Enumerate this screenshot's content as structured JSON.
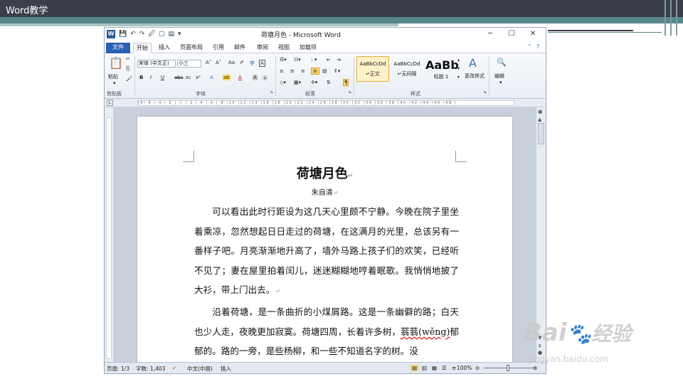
{
  "slide": {
    "title": "Word教学"
  },
  "window": {
    "title": "荷塘月色 - Microsoft Word",
    "controls": {
      "minimize": "─",
      "maximize": "☐",
      "close": "✕"
    },
    "quick_access": [
      "💾",
      "↶",
      "↷",
      "🖉",
      "▢",
      "▤",
      "▾"
    ]
  },
  "tabs": {
    "file": "文件",
    "home": "开始",
    "insert": "插入",
    "layout": "页面布局",
    "references": "引用",
    "mailings": "邮件",
    "review": "审阅",
    "view": "视图",
    "addins": "加载项",
    "help": "?"
  },
  "ribbon": {
    "clipboard": {
      "paste": "粘贴",
      "label": "剪贴板"
    },
    "font": {
      "name": "宋体 (中文正)",
      "size": "小三",
      "label": "字体",
      "buttons": [
        "B",
        "I",
        "U",
        "abc",
        "x₂",
        "x²",
        "A",
        "A",
        "Aa",
        "A",
        "ㅅ",
        "A",
        "Ⓐ",
        "字"
      ]
    },
    "paragraph": {
      "label": "段落"
    },
    "styles": {
      "label": "样式",
      "items": [
        {
          "sample": "AaBbCcDd",
          "name": "↵正文"
        },
        {
          "sample": "AaBbCcDd",
          "name": "↵无间隔"
        },
        {
          "sample": "AaBb",
          "name": "标题 1"
        }
      ],
      "change": "更改样式"
    },
    "editing": {
      "label": "编辑"
    }
  },
  "ruler": {
    "marks": "|8|·6·|·4·|·2·|·▽·|·2·|·4·|·6·|·8·|10·|12·|14·|16·|18·|20·|22·|24·|26·|28·|30·|32·|34·|36·|38·|40·|42·|44·|46·|48·|"
  },
  "document": {
    "title": "荷塘月色",
    "title_mark": "↵",
    "author": "朱自清",
    "author_mark": "↵",
    "para1": "可以看出此时行距设为这几天心里颇不宁静。今晚在院子里坐着乘凉，忽然想起日日走过的荷塘，在这满月的光里，总该另有一番样子吧。月亮渐渐地升高了，墙外马路上孩子们的欢笑，已经听不见了；妻在屋里拍着闰儿，迷迷糊糊地哼着眠歌。我悄悄地披了大衫，带上门出去。",
    "para1_mark": "↵",
    "para2_a": "沿着荷塘，是一条曲折的小煤屑路。这是一条幽僻的路；白天也少人走，夜晚更加寂寞。荷塘四周，长着许多树，",
    "para2_u1": "蓊蓊(wě",
    "para2_u2": "ng)",
    "para2_b": "郁郁的。路的一旁，是些杨柳，和一些不知道名字的树。没"
  },
  "statusbar": {
    "page": "页面: 1/3",
    "words": "字数: 1,403",
    "lang": "中文(中国)",
    "mode": "插入",
    "zoom": "100%",
    "zoom_minus": "⊖",
    "zoom_plus": "⊕"
  },
  "watermark": {
    "brand": "Bai",
    "brand2": "经验",
    "url": "jingyan.baidu.com"
  }
}
